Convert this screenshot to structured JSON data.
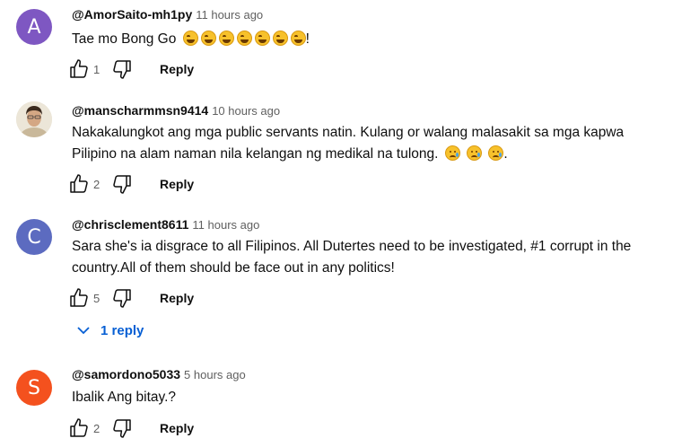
{
  "comments": [
    {
      "avatar_letter": "A",
      "avatar_color": "#7e57c2",
      "author": "@AmorSaito-mh1py",
      "time": "11 hours ago",
      "text": "Tae mo Bong Go",
      "text_suffix": "!",
      "likes": "1",
      "reply_label": "Reply"
    },
    {
      "avatar_letter": "",
      "avatar_color": "#e9e2d4",
      "author": "@manscharmmsn9414",
      "time": "10 hours ago",
      "text": "Nakakalungkot ang mga public servants natin. Kulang or walang malasakit sa mga kapwa Pilipino na alam naman nila kelangan ng medikal na tulong.",
      "text_suffix": ".",
      "likes": "2",
      "reply_label": "Reply"
    },
    {
      "avatar_letter": "C",
      "avatar_color": "#5c6bc0",
      "author": "@chrisclement8611",
      "time": "11 hours ago",
      "text": "Sara she's ia disgrace to all Filipinos. All Dutertes need to be investigated, #1 corrupt in the country.All of them should be face out in any politics!",
      "likes": "5",
      "reply_label": "Reply",
      "replies_label": "1 reply"
    },
    {
      "avatar_letter": "S",
      "avatar_color": "#f4511e",
      "author": "@samordono5033",
      "time": "5 hours ago",
      "text": "Ibalik Ang bitay.?",
      "likes": "2",
      "reply_label": "Reply"
    }
  ],
  "icons": {
    "like": "thumbs-up-icon",
    "dislike": "thumbs-down-icon",
    "chevron": "chevron-down-icon",
    "laugh": "laughing-emoji",
    "sad": "sad-tear-emoji"
  },
  "colors": {
    "link": "#065fd4",
    "secondary_text": "#606060"
  }
}
